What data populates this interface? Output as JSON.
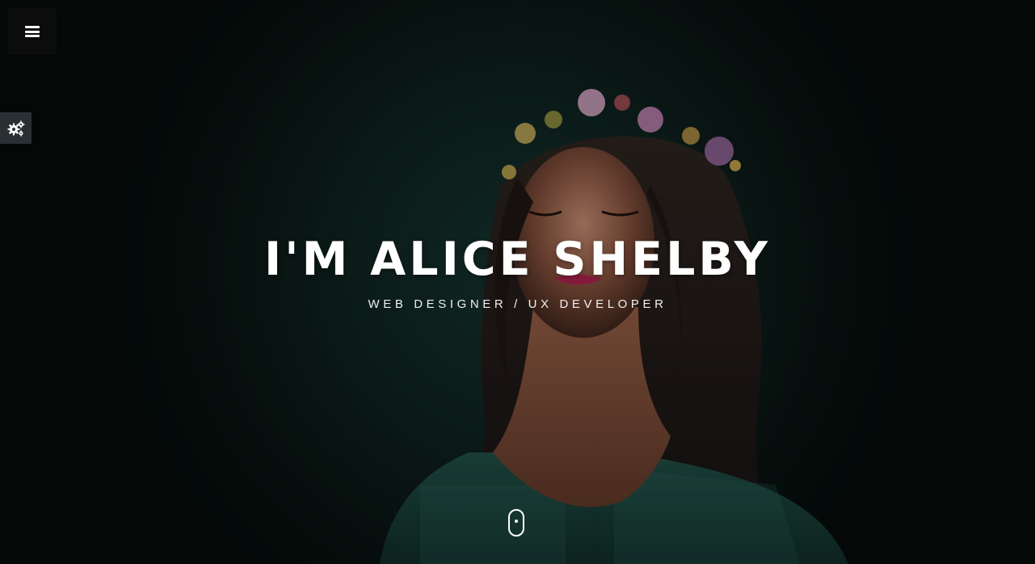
{
  "nav": {
    "menu_icon": "hamburger-icon",
    "settings_icon": "gears-icon"
  },
  "hero": {
    "title": "I'M ALICE SHELBY",
    "subtitle": "WEB DESIGNER / UX DEVELOPER",
    "scroll_icon": "mouse-scroll-icon"
  },
  "colors": {
    "background": "#0b1513",
    "text": "#ffffff",
    "menu_button_bg": "#0c0c0c",
    "settings_button_bg": "#2a2f33"
  }
}
